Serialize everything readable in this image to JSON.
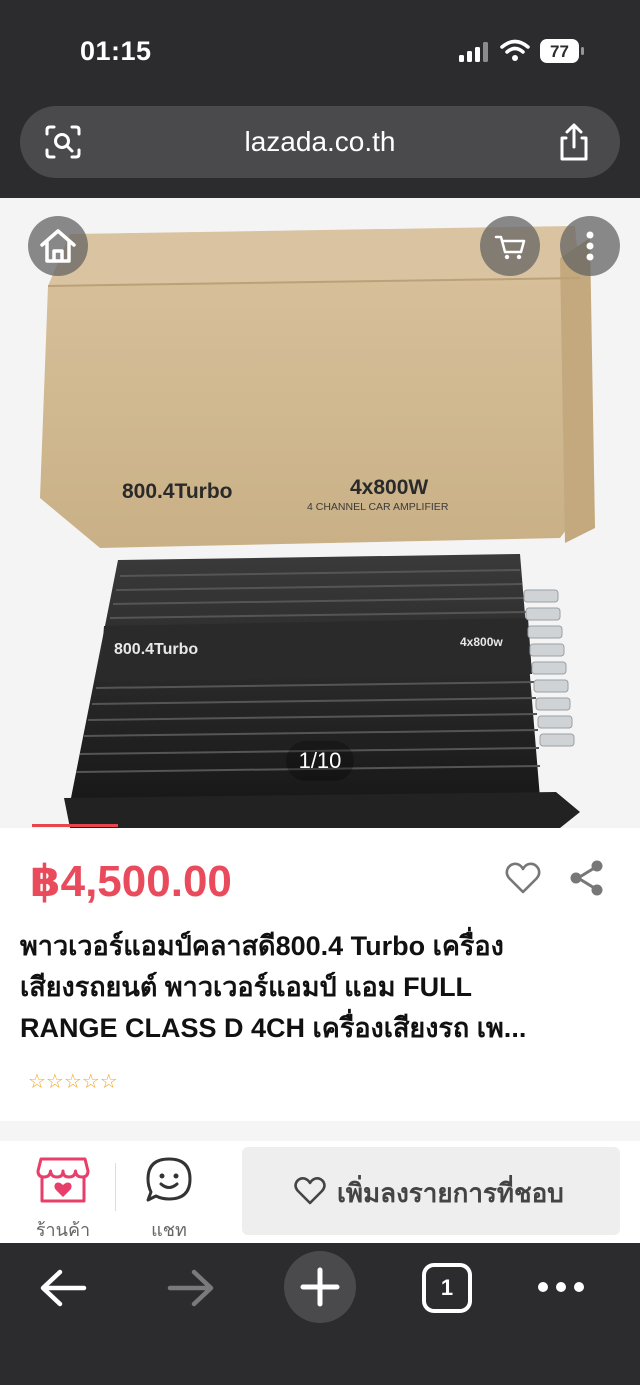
{
  "status": {
    "time": "01:15",
    "battery": "77"
  },
  "url_bar": {
    "domain": "lazada.co.th"
  },
  "gallery": {
    "counter": "1/10",
    "current_image": 1,
    "total_images": 10,
    "box_model": "800.4Turbo",
    "box_power": "4x800W",
    "box_subtitle": "4 CHANNEL CAR AMPLIFIER",
    "amp_model": "800.4Turbo",
    "amp_power": "4x800w"
  },
  "product": {
    "price": "฿4,500.00",
    "title_lines": [
      "พาวเวอร์แอมป์คลาสดี800.4 Turbo เครื่อง",
      "เสียงรถยนต์ พาวเวอร์แอมป์ แอม FULL",
      "RANGE CLASS D 4CH เครื่องเสียงรถ เพ..."
    ],
    "rating_stars": "☆☆☆☆☆",
    "rating_value": 0
  },
  "actions": {
    "shop_label": "ร้านค้า",
    "chat_label": "แชท",
    "wishlist_label": "เพิ่มลงรายการที่ชอบ"
  },
  "toolbar": {
    "tab_count": "1"
  },
  "colors": {
    "price": "#e94b5c",
    "brand_pink": "#e83e6a",
    "rating": "#f5a623",
    "chrome": "#2c2c2e"
  }
}
